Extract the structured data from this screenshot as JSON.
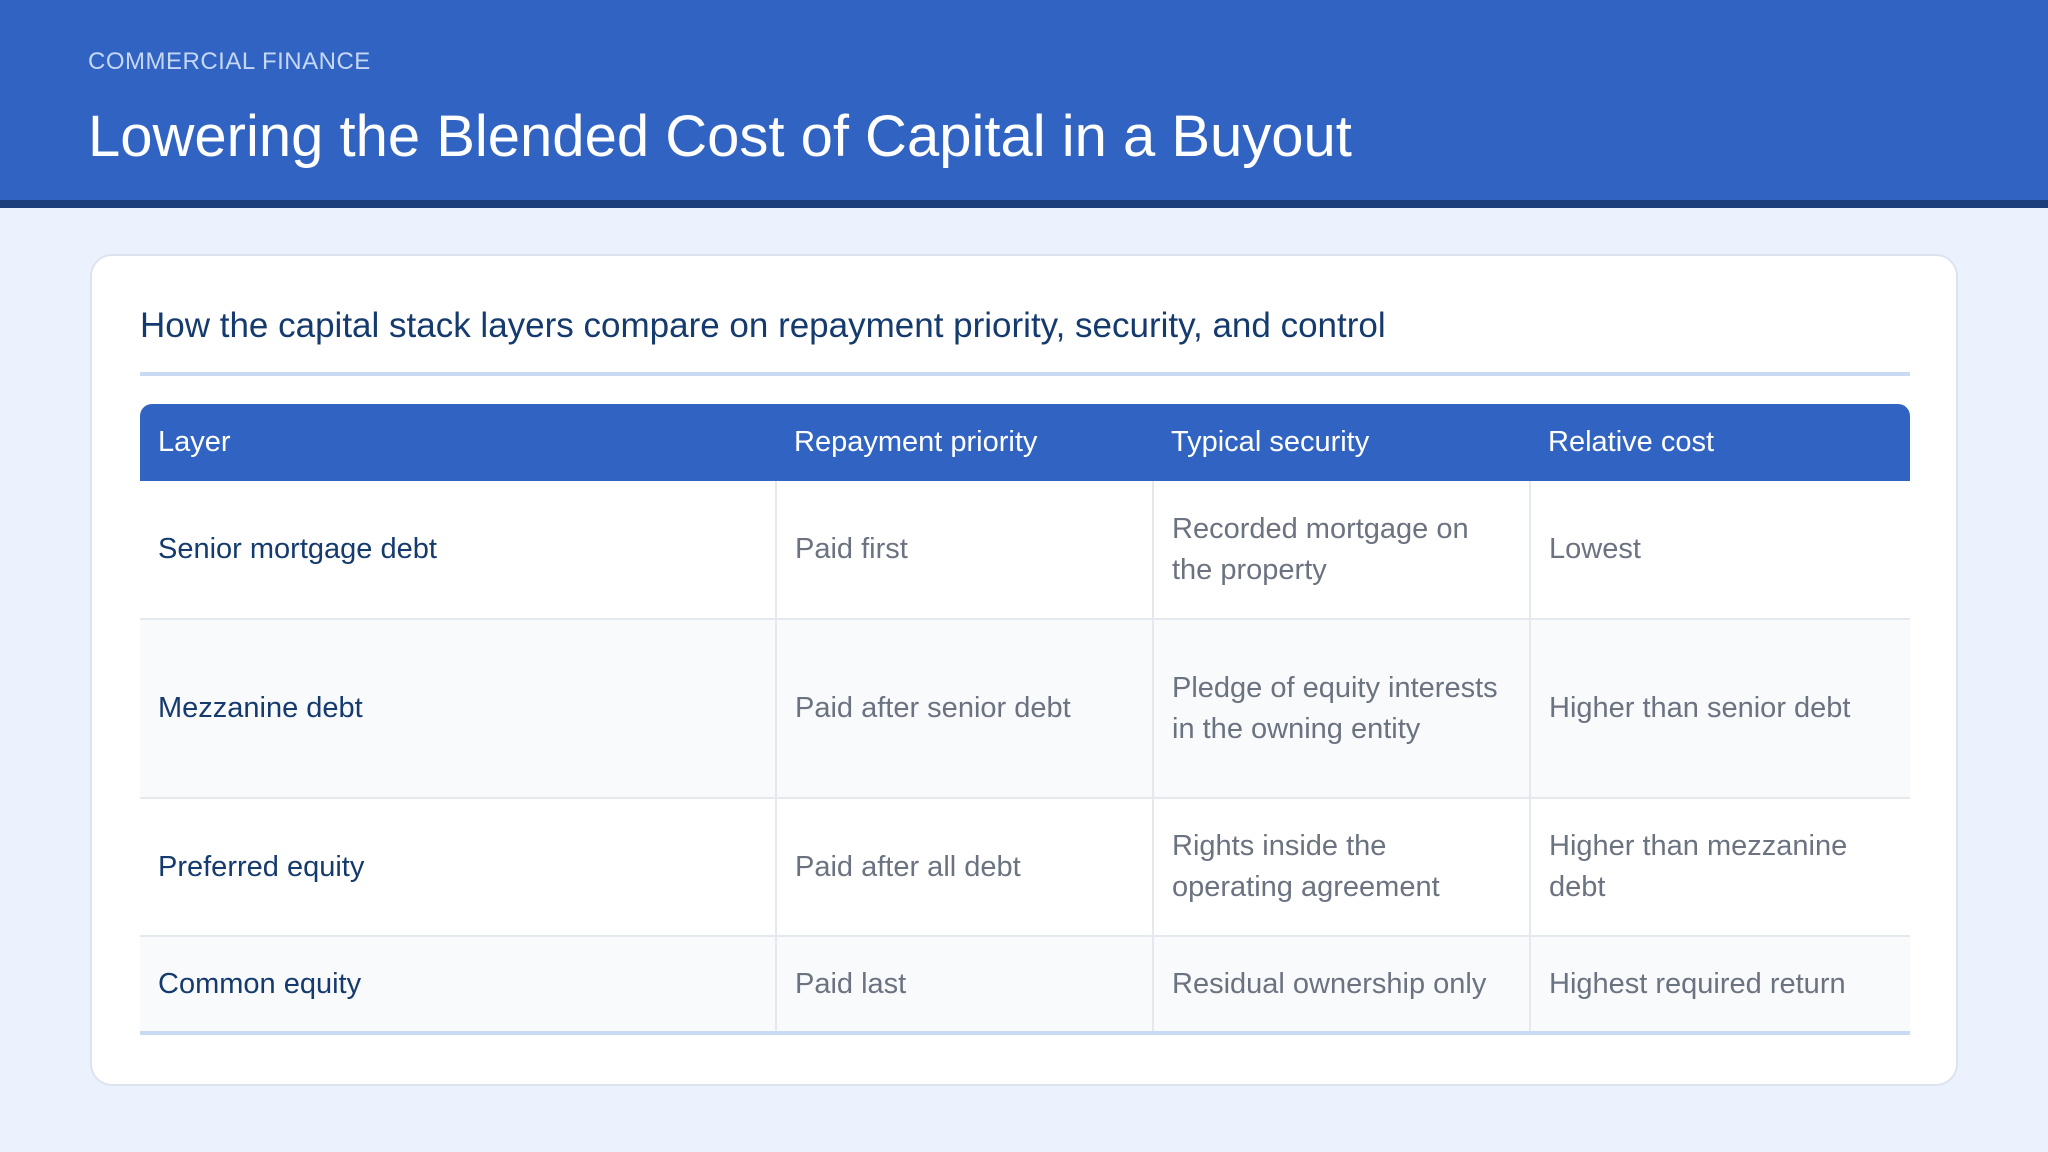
{
  "header": {
    "eyebrow": "COMMERCIAL FINANCE",
    "title": "Lowering the Blended Cost of Capital in a Buyout"
  },
  "card": {
    "subtitle": "How the capital stack layers compare on repayment priority, security, and control"
  },
  "table": {
    "columns": [
      "Layer",
      "Repayment priority",
      "Typical security",
      "Relative cost"
    ],
    "rows": [
      [
        "Senior mortgage debt",
        "Paid first",
        "Recorded mortgage on the property",
        "Lowest"
      ],
      [
        "Mezzanine debt",
        "Paid after senior debt",
        "Pledge of equity interests in the owning entity",
        "Higher than senior debt"
      ],
      [
        "Preferred equity",
        "Paid after all debt",
        "Rights inside the operating agreement",
        "Higher than mezzanine debt"
      ],
      [
        "Common equity",
        "Paid last",
        "Residual ownership only",
        "Highest required return"
      ]
    ]
  },
  "colors": {
    "header_bg": "#3164c2",
    "header_border": "#1a3f7a",
    "page_bg": "#ebf2fd",
    "accent_text": "#153a6e",
    "muted_text": "#6b7280"
  }
}
